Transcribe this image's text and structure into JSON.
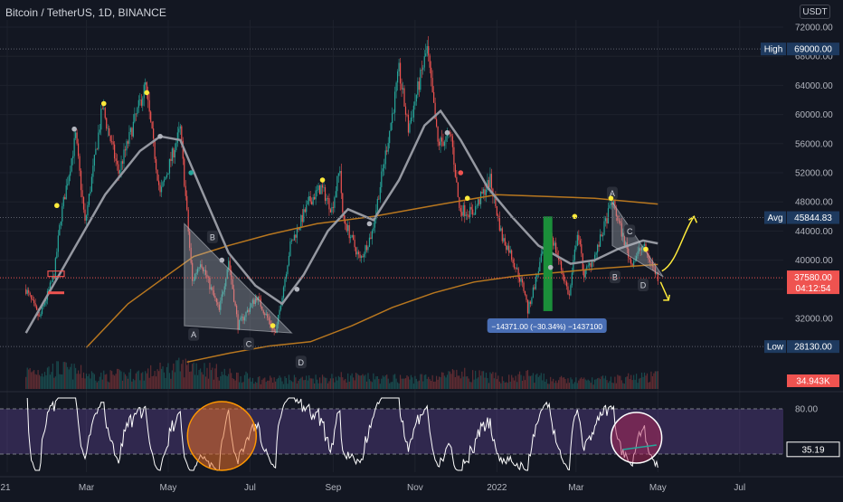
{
  "header": {
    "symbol_title": "Bitcoin / TetherUS, 1D, BINANCE",
    "currency": "USDT"
  },
  "colors": {
    "background": "#131722",
    "up_candle": "#26a69a",
    "down_candle": "#ef5350",
    "ma_fast": "#9598a1",
    "ma_slow": "#b8771f",
    "rsi_line": "#ffffff",
    "rsi_band": "#7e57c2",
    "label_bg": "#1e3a5f",
    "last_price": "#ef5350",
    "annotation_yellow": "#ffeb3b",
    "measure_green": "#1b8f3a"
  },
  "chart_data": {
    "type": "candlestick",
    "y_axis": {
      "ticks": [
        32000,
        36000,
        40000,
        44000,
        48000,
        52000,
        56000,
        60000,
        64000,
        68000,
        72000
      ],
      "tick_labels": [
        "32000.00",
        "36000.00",
        "40000.00",
        "44000.00",
        "48000.00",
        "52000.00",
        "56000.00",
        "60000.00",
        "64000.00",
        "68000.00",
        "72000.00"
      ],
      "range": [
        27000,
        73000
      ]
    },
    "x_axis": {
      "tick_labels": [
        "21",
        "Mar",
        "May",
        "Jul",
        "Sep",
        "Nov",
        "2022",
        "Mar",
        "May",
        "Jul"
      ]
    },
    "price_path": [
      [
        "2021-01-15",
        36000
      ],
      [
        "2021-01-25",
        32000
      ],
      [
        "2021-02-05",
        38000
      ],
      [
        "2021-02-10",
        46000
      ],
      [
        "2021-02-21",
        57000
      ],
      [
        "2021-02-28",
        45000
      ],
      [
        "2021-03-13",
        61000
      ],
      [
        "2021-03-25",
        52000
      ],
      [
        "2021-04-14",
        64000
      ],
      [
        "2021-04-25",
        49000
      ],
      [
        "2021-05-10",
        58000
      ],
      [
        "2021-05-19",
        37000
      ],
      [
        "2021-05-25",
        40000
      ],
      [
        "2021-06-08",
        33000
      ],
      [
        "2021-06-15",
        40000
      ],
      [
        "2021-06-22",
        31000
      ],
      [
        "2021-07-06",
        35000
      ],
      [
        "2021-07-20",
        29800
      ],
      [
        "2021-07-31",
        42000
      ],
      [
        "2021-08-14",
        48000
      ],
      [
        "2021-08-23",
        50000
      ],
      [
        "2021-08-31",
        47000
      ],
      [
        "2021-09-06",
        52700
      ],
      [
        "2021-09-08",
        46000
      ],
      [
        "2021-09-21",
        40000
      ],
      [
        "2021-09-30",
        43800
      ],
      [
        "2021-10-15",
        60000
      ],
      [
        "2021-10-20",
        66000
      ],
      [
        "2021-10-27",
        58000
      ],
      [
        "2021-11-10",
        69000
      ],
      [
        "2021-11-18",
        56000
      ],
      [
        "2021-11-28",
        57000
      ],
      [
        "2021-12-04",
        47000
      ],
      [
        "2021-12-14",
        46500
      ],
      [
        "2021-12-27",
        51000
      ],
      [
        "2022-01-05",
        43000
      ],
      [
        "2022-01-10",
        41500
      ],
      [
        "2022-01-22",
        35500
      ],
      [
        "2022-01-24",
        33000
      ],
      [
        "2022-02-09",
        44500
      ],
      [
        "2022-02-24",
        35000
      ],
      [
        "2022-03-02",
        44000
      ],
      [
        "2022-03-07",
        38000
      ],
      [
        "2022-03-16",
        41000
      ],
      [
        "2022-03-28",
        48200
      ],
      [
        "2022-04-11",
        39500
      ],
      [
        "2022-04-20",
        42000
      ],
      [
        "2022-05-01",
        37580
      ]
    ],
    "ma_fast_path": [
      [
        "2021-01-15",
        30000
      ],
      [
        "2021-02-15",
        40000
      ],
      [
        "2021-03-15",
        49000
      ],
      [
        "2021-04-10",
        55000
      ],
      [
        "2021-04-25",
        57000
      ],
      [
        "2021-05-10",
        56500
      ],
      [
        "2021-05-25",
        50000
      ],
      [
        "2021-06-15",
        41000
      ],
      [
        "2021-07-05",
        36500
      ],
      [
        "2021-07-25",
        34000
      ],
      [
        "2021-08-10",
        38000
      ],
      [
        "2021-08-28",
        44000
      ],
      [
        "2021-09-12",
        47000
      ],
      [
        "2021-10-01",
        45500
      ],
      [
        "2021-10-20",
        51000
      ],
      [
        "2021-11-08",
        58500
      ],
      [
        "2021-11-20",
        60500
      ],
      [
        "2021-12-05",
        56500
      ],
      [
        "2021-12-25",
        50000
      ],
      [
        "2022-01-12",
        46000
      ],
      [
        "2022-02-01",
        42000
      ],
      [
        "2022-02-25",
        39500
      ],
      [
        "2022-03-15",
        40000
      ],
      [
        "2022-04-01",
        41500
      ],
      [
        "2022-04-20",
        42700
      ],
      [
        "2022-05-01",
        42300
      ]
    ],
    "ma_slow_path": [
      [
        "2021-03-01",
        28000
      ],
      [
        "2021-04-01",
        34000
      ],
      [
        "2021-05-01",
        38000
      ],
      [
        "2021-05-20",
        40500
      ],
      [
        "2021-06-15",
        42000
      ],
      [
        "2021-07-15",
        43500
      ],
      [
        "2021-08-20",
        45000
      ],
      [
        "2021-10-01",
        46000
      ],
      [
        "2021-11-15",
        47500
      ],
      [
        "2022-01-01",
        49000
      ],
      [
        "2022-03-15",
        48500
      ],
      [
        "2022-05-01",
        47700
      ]
    ],
    "ma_slow_lower_path": [
      [
        "2021-05-15",
        26000
      ],
      [
        "2021-06-15",
        27200
      ],
      [
        "2021-07-15",
        28200
      ],
      [
        "2021-08-15",
        28800
      ],
      [
        "2021-09-15",
        31000
      ],
      [
        "2021-10-15",
        33500
      ],
      [
        "2021-11-15",
        35500
      ],
      [
        "2021-12-15",
        37000
      ],
      [
        "2022-01-15",
        37800
      ],
      [
        "2022-02-15",
        38300
      ],
      [
        "2022-03-15",
        38800
      ],
      [
        "2022-04-15",
        39200
      ],
      [
        "2022-05-01",
        39400
      ]
    ],
    "volume_path": [
      [
        "2021-01-10",
        18
      ],
      [
        "2021-02-10",
        22
      ],
      [
        "2021-03-10",
        14
      ],
      [
        "2021-04-10",
        16
      ],
      [
        "2021-05-19",
        26
      ],
      [
        "2021-06-10",
        17
      ],
      [
        "2021-07-10",
        10
      ],
      [
        "2021-08-10",
        11
      ],
      [
        "2021-09-10",
        13
      ],
      [
        "2021-10-10",
        11
      ],
      [
        "2021-11-10",
        12
      ],
      [
        "2021-12-05",
        16
      ],
      [
        "2022-01-10",
        11
      ],
      [
        "2022-01-24",
        15
      ],
      [
        "2022-02-10",
        10
      ],
      [
        "2022-03-10",
        9
      ],
      [
        "2022-04-10",
        12
      ],
      [
        "2022-05-01",
        14
      ]
    ],
    "rsi": {
      "upper_label": "80.00",
      "current_value": "35.19",
      "upper_level": 80,
      "current_level": 35.19
    },
    "price_labels": {
      "high": {
        "name": "High",
        "value": "69000.00",
        "price": 69000
      },
      "avg": {
        "name": "Avg",
        "value": "45844.83",
        "price": 45844.83
      },
      "last": {
        "value": "37580.00",
        "countdown": "04:12:54",
        "price": 37580
      },
      "low": {
        "name": "Low",
        "value": "28130.00",
        "price": 28130
      },
      "volume": {
        "value": "34.943K"
      }
    },
    "measure": {
      "label": "−14371.00 (−30.34%) −1437100",
      "from": [
        "2022-02-08",
        46000
      ],
      "to": [
        "2022-02-08",
        33000
      ]
    },
    "pattern_points": [
      {
        "label": "A",
        "date": "2021-05-20",
        "price": 29800
      },
      {
        "label": "B",
        "date": "2021-06-03",
        "price": 43200
      },
      {
        "label": "C",
        "date": "2021-06-30",
        "price": 28500
      },
      {
        "label": "D",
        "date": "2021-08-08",
        "price": 26000
      },
      {
        "label": "A",
        "date": "2022-03-28",
        "price": 49200
      },
      {
        "label": "B",
        "date": "2022-03-30",
        "price": 37700
      },
      {
        "label": "C",
        "date": "2022-04-10",
        "price": 44000
      },
      {
        "label": "D",
        "date": "2022-04-20",
        "price": 36600
      }
    ],
    "triangles": [
      [
        [
          "2021-05-13",
          45000
        ],
        [
          "2021-05-13",
          31000
        ],
        [
          "2021-08-01",
          30000
        ]
      ],
      [
        [
          "2022-03-28",
          48000
        ],
        [
          "2022-03-28",
          42000
        ],
        [
          "2022-05-05",
          37700
        ]
      ]
    ],
    "grid": true
  }
}
